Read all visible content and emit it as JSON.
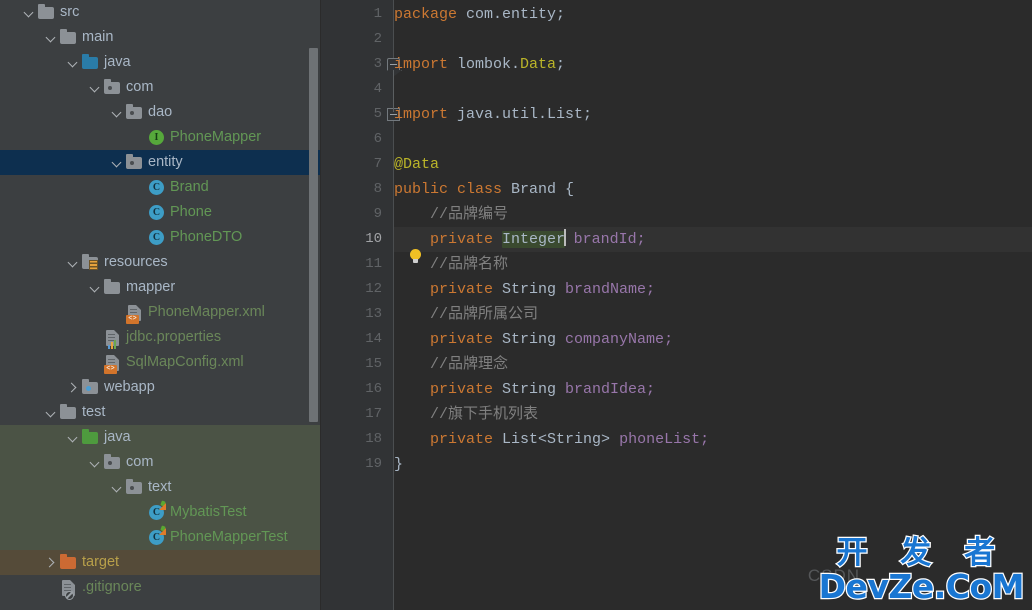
{
  "tree": {
    "rows": [
      {
        "indent": 0,
        "arrow": "down",
        "icon": "folder-gray",
        "label": "src",
        "color": "plain"
      },
      {
        "indent": 1,
        "arrow": "down",
        "icon": "folder-gray",
        "label": "main",
        "color": "plain"
      },
      {
        "indent": 2,
        "arrow": "down",
        "icon": "folder-blue",
        "label": "java",
        "color": "plain"
      },
      {
        "indent": 3,
        "arrow": "down",
        "icon": "package",
        "label": "com",
        "color": "plain"
      },
      {
        "indent": 4,
        "arrow": "down",
        "icon": "package",
        "label": "dao",
        "color": "plain"
      },
      {
        "indent": 5,
        "arrow": "none",
        "icon": "interface",
        "label": "PhoneMapper",
        "color": "green"
      },
      {
        "indent": 4,
        "arrow": "down",
        "icon": "package",
        "label": "entity",
        "color": "plain",
        "state": "selected"
      },
      {
        "indent": 5,
        "arrow": "none",
        "icon": "class",
        "label": "Brand",
        "color": "green"
      },
      {
        "indent": 5,
        "arrow": "none",
        "icon": "class",
        "label": "Phone",
        "color": "green"
      },
      {
        "indent": 5,
        "arrow": "none",
        "icon": "class",
        "label": "PhoneDTO",
        "color": "green"
      },
      {
        "indent": 2,
        "arrow": "down",
        "icon": "folder-res",
        "label": "resources",
        "color": "plain"
      },
      {
        "indent": 3,
        "arrow": "down",
        "icon": "folder-gray",
        "label": "mapper",
        "color": "plain"
      },
      {
        "indent": 4,
        "arrow": "none",
        "icon": "file-xml",
        "label": "PhoneMapper.xml",
        "color": "file-green"
      },
      {
        "indent": 3,
        "arrow": "none",
        "icon": "file-props",
        "label": "jdbc.properties",
        "color": "file-green"
      },
      {
        "indent": 3,
        "arrow": "none",
        "icon": "file-xml",
        "label": "SqlMapConfig.xml",
        "color": "file-green"
      },
      {
        "indent": 2,
        "arrow": "right",
        "icon": "folder-web",
        "label": "webapp",
        "color": "plain"
      },
      {
        "indent": 1,
        "arrow": "down",
        "icon": "folder-gray",
        "label": "test",
        "color": "plain"
      },
      {
        "indent": 2,
        "arrow": "down",
        "icon": "folder-green",
        "label": "java",
        "color": "plain",
        "tint": "test"
      },
      {
        "indent": 3,
        "arrow": "down",
        "icon": "package",
        "label": "com",
        "color": "plain",
        "tint": "test"
      },
      {
        "indent": 4,
        "arrow": "down",
        "icon": "package",
        "label": "text",
        "color": "plain",
        "tint": "test"
      },
      {
        "indent": 5,
        "arrow": "none",
        "icon": "class-test",
        "label": "MybatisTest",
        "color": "green",
        "tint": "test"
      },
      {
        "indent": 5,
        "arrow": "none",
        "icon": "class-test",
        "label": "PhoneMapperTest",
        "color": "green",
        "tint": "test"
      },
      {
        "indent": 1,
        "arrow": "right",
        "icon": "folder-orange",
        "label": "target",
        "color": "orange",
        "tint": "target"
      },
      {
        "indent": 1,
        "arrow": "none",
        "icon": "file-git",
        "label": ".gitignore",
        "color": "file-green"
      }
    ]
  },
  "editor": {
    "current_line": 10,
    "lines": [
      {
        "n": 1,
        "fold": "none",
        "tokens": [
          {
            "t": "package ",
            "c": "kw"
          },
          {
            "t": "com.entity;",
            "c": "pkg"
          }
        ]
      },
      {
        "n": 2,
        "fold": "none",
        "tokens": []
      },
      {
        "n": 3,
        "fold": "start",
        "tokens": [
          {
            "t": "import ",
            "c": "kw"
          },
          {
            "t": "lombok.",
            "c": "pkg"
          },
          {
            "t": "Data",
            "c": "ann"
          },
          {
            "t": ";",
            "c": "pkg"
          }
        ]
      },
      {
        "n": 4,
        "fold": "none",
        "tokens": []
      },
      {
        "n": 5,
        "fold": "end",
        "tokens": [
          {
            "t": "import ",
            "c": "kw"
          },
          {
            "t": "java.util.List;",
            "c": "pkg"
          }
        ]
      },
      {
        "n": 6,
        "fold": "none",
        "tokens": []
      },
      {
        "n": 7,
        "fold": "none",
        "tokens": [
          {
            "t": "@Data",
            "c": "ann"
          }
        ]
      },
      {
        "n": 8,
        "fold": "none",
        "tokens": [
          {
            "t": "public class ",
            "c": "kw"
          },
          {
            "t": "Brand ",
            "c": "cls"
          },
          {
            "t": "{",
            "c": "plain"
          }
        ]
      },
      {
        "n": 9,
        "fold": "none",
        "tokens": [
          {
            "t": "    //品牌编号",
            "c": "cmt"
          }
        ]
      },
      {
        "n": 10,
        "fold": "none",
        "tokens": [
          {
            "t": "    ",
            "c": "plain"
          },
          {
            "t": "private ",
            "c": "kw"
          },
          {
            "t": "Integer",
            "c": "type",
            "sel": true
          },
          {
            "t": "CARET",
            "c": "caret"
          },
          {
            "t": " ",
            "c": "plain"
          },
          {
            "t": "brandId;",
            "c": "fld"
          }
        ]
      },
      {
        "n": 11,
        "fold": "none",
        "tokens": [
          {
            "t": "    //品牌名称",
            "c": "cmt"
          }
        ]
      },
      {
        "n": 12,
        "fold": "none",
        "tokens": [
          {
            "t": "    ",
            "c": "plain"
          },
          {
            "t": "private ",
            "c": "kw"
          },
          {
            "t": "String ",
            "c": "type"
          },
          {
            "t": "brandName;",
            "c": "fld"
          }
        ]
      },
      {
        "n": 13,
        "fold": "none",
        "tokens": [
          {
            "t": "    //品牌所属公司",
            "c": "cmt"
          }
        ]
      },
      {
        "n": 14,
        "fold": "none",
        "tokens": [
          {
            "t": "    ",
            "c": "plain"
          },
          {
            "t": "private ",
            "c": "kw"
          },
          {
            "t": "String ",
            "c": "type"
          },
          {
            "t": "companyName;",
            "c": "fld"
          }
        ]
      },
      {
        "n": 15,
        "fold": "none",
        "tokens": [
          {
            "t": "    //品牌理念",
            "c": "cmt"
          }
        ]
      },
      {
        "n": 16,
        "fold": "none",
        "tokens": [
          {
            "t": "    ",
            "c": "plain"
          },
          {
            "t": "private ",
            "c": "kw"
          },
          {
            "t": "String ",
            "c": "type"
          },
          {
            "t": "brandIdea;",
            "c": "fld"
          }
        ]
      },
      {
        "n": 17,
        "fold": "none",
        "tokens": [
          {
            "t": "    //旗下手机列表",
            "c": "cmt"
          }
        ]
      },
      {
        "n": 18,
        "fold": "none",
        "tokens": [
          {
            "t": "    ",
            "c": "plain"
          },
          {
            "t": "private ",
            "c": "kw"
          },
          {
            "t": "List<String> ",
            "c": "type"
          },
          {
            "t": "phoneList;",
            "c": "fld"
          }
        ]
      },
      {
        "n": 19,
        "fold": "none",
        "tokens": [
          {
            "t": "}",
            "c": "plain"
          }
        ]
      }
    ]
  },
  "watermark": {
    "csdn": "CSDN",
    "line1": "开 发 者",
    "line2": "DevZe.CoM"
  },
  "colors": {
    "tree_bg": "#3c3f41",
    "editor_bg": "#2b2b2b",
    "gutter_bg": "#313335",
    "selection_row": "#0d2f4f",
    "test_tint": "#4b5345",
    "target_tint": "#554b39",
    "keyword": "#cc7832",
    "field": "#9876aa",
    "annotation": "#bbb529",
    "comment": "#808080",
    "text": "#a9b7c6",
    "watermark_blue": "#1976d2"
  }
}
